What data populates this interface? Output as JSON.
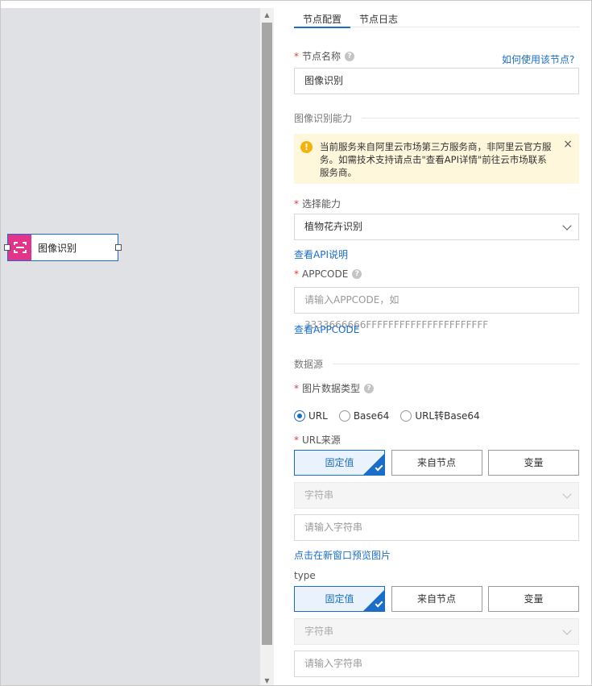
{
  "canvas": {
    "node": {
      "label": "图像识别",
      "icon": "qr-scan-icon",
      "accent": "#e4338a"
    }
  },
  "panel": {
    "tabs": [
      {
        "label": "节点配置",
        "active": true
      },
      {
        "label": "节点日志",
        "active": false
      }
    ],
    "node_name": {
      "label": "节点名称",
      "help_link": "如何使用该节点?",
      "value": "图像识别"
    },
    "section_ability": "图像识别能力",
    "alert": {
      "text": "当前服务来自阿里云市场第三方服务商，非阿里云官方服务。如需技术支持请点击\"查看API详情\"前往云市场联系服务商。",
      "close": "×"
    },
    "ability": {
      "label": "选择能力",
      "value": "植物花卉识别",
      "link": "查看API说明"
    },
    "appcode": {
      "label": "APPCODE",
      "placeholder": "请输入APPCODE，如3333666666FFFFFFFFFFFFFFFFFFFFFF",
      "link": "查看APPCODE"
    },
    "section_source": "数据源",
    "image_type": {
      "label": "图片数据类型",
      "options": [
        {
          "label": "URL",
          "checked": true
        },
        {
          "label": "Base64",
          "checked": false
        },
        {
          "label": "URL转Base64",
          "checked": false
        }
      ]
    },
    "url_source": {
      "label": "URL来源",
      "buttons": [
        "固定值",
        "来自节点",
        "变量"
      ],
      "type_select": "字符串",
      "placeholder": "请输入字符串",
      "preview_link": "点击在新窗口预览图片"
    },
    "type_field": {
      "label": "type",
      "buttons": [
        "固定值",
        "来自节点",
        "变量"
      ],
      "type_select": "字符串",
      "placeholder": "请输入字符串"
    }
  },
  "colors": {
    "primary": "#1a6ec8",
    "required": "#e4393c",
    "alert_bg": "#fff7dc",
    "warning": "#f5b20a"
  }
}
